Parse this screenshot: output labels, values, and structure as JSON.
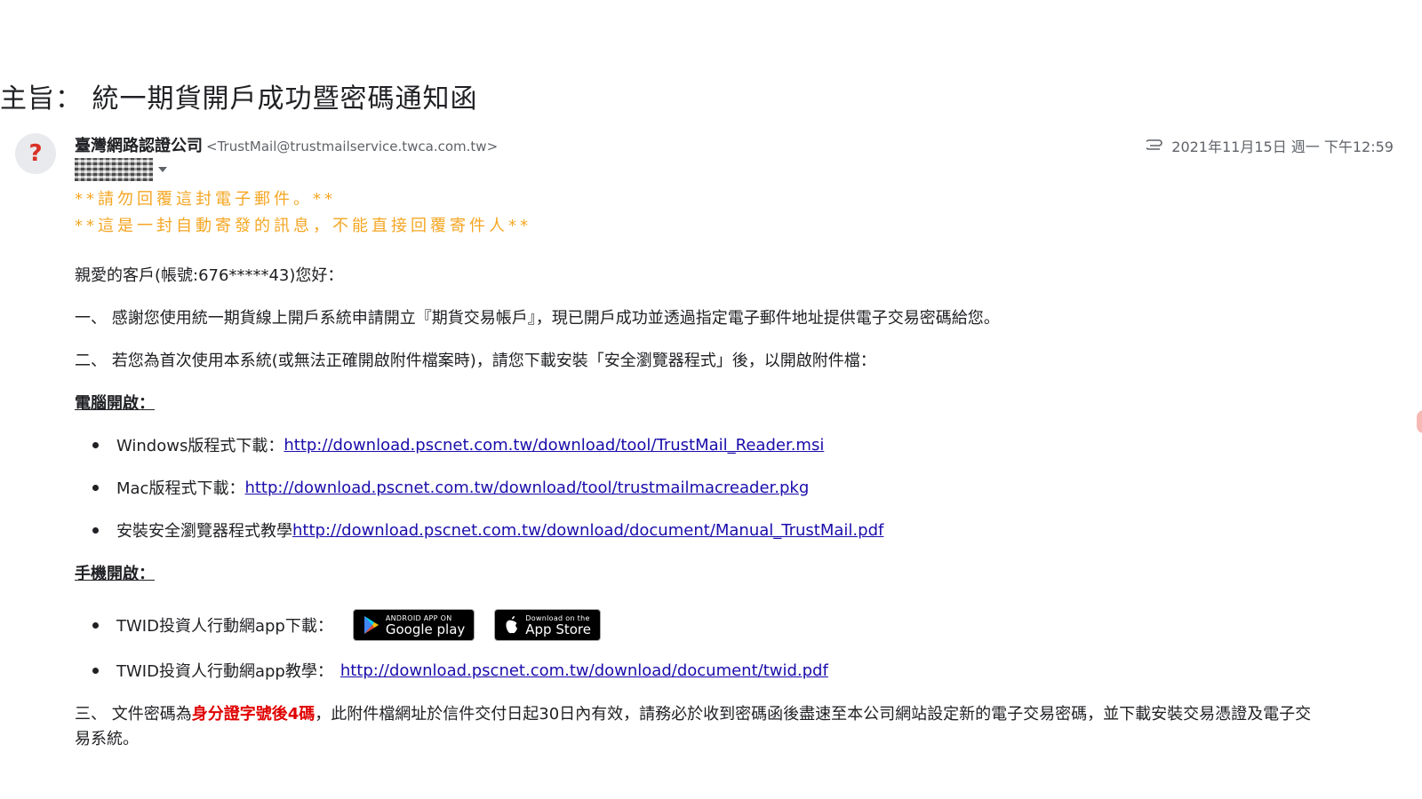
{
  "email": {
    "subject": "主旨： 統一期貨開戶成功暨密碼通知函",
    "sender_name": "臺灣網路認證公司",
    "sender_email": "<TrustMail@trustmailservice.twca.com.tw>",
    "date": "2021年11月15日 週一 下午12:59",
    "avatar_glyph": "?"
  },
  "warnings": {
    "line1": "**請勿回覆這封電子郵件。**",
    "line2": "**這是一封自動寄發的訊息，不能直接回覆寄件人**"
  },
  "body": {
    "greeting": "親愛的客戶(帳號:676*****43)您好：",
    "para1": "一、 感謝您使用統一期貨線上開戶系統申請開立『期貨交易帳戶』，現已開戶成功並透過指定電子郵件地址提供電子交易密碼給您。",
    "para2": "二、 若您為首次使用本系統(或無法正確開啟附件檔案時)，請您下載安裝「安全瀏覽器程式」後，以開啟附件檔：",
    "pc_heading": "電腦開啟：",
    "pc_items": [
      {
        "label": "Windows版程式下載：",
        "link": "http://download.pscnet.com.tw/download/tool/TrustMail_Reader.msi"
      },
      {
        "label": "Mac版程式下載：",
        "link": "http://download.pscnet.com.tw/download/tool/trustmailmacreader.pkg"
      },
      {
        "label": "安裝安全瀏覽器程式教學",
        "link": "http://download.pscnet.com.tw/download/document/Manual_TrustMail.pdf"
      }
    ],
    "mobile_heading": "手機開啟：",
    "mobile_items": [
      {
        "label": "TWID投資人行動網app下載："
      },
      {
        "label": "TWID投資人行動網app教學：",
        "link": "http://download.pscnet.com.tw/download/document/twid.pdf"
      }
    ],
    "google_play": {
      "small": "ANDROID APP ON",
      "big": "Google play"
    },
    "app_store": {
      "small": "Download on the",
      "big": "App Store"
    },
    "para3_prefix": "三、 文件密碼為",
    "para3_highlight": "身分證字號後4碼",
    "para3_suffix": "，此附件檔網址於信件交付日起30日內有效，請務必於收到密碼函後盡速至本公司網站設定新的電子交易密碼，並下載安裝交易憑證及電子交",
    "para3_line2": "易系統。"
  },
  "colors": {
    "warning": "#f5a623",
    "link": "#1a0dab",
    "highlight": "#e00000"
  },
  "icons": [
    "question-avatar-icon",
    "paperclip-icon",
    "chevron-down-icon",
    "google-play-icon",
    "apple-icon"
  ]
}
